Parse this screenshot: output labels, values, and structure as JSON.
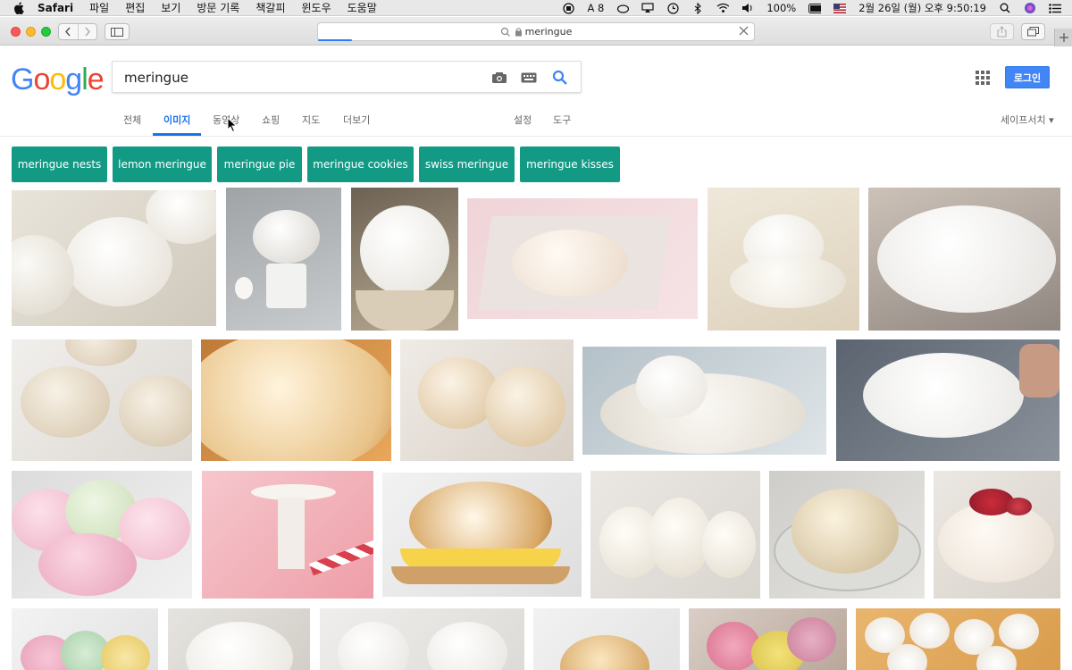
{
  "menubar": {
    "items": [
      "Safari",
      "파일",
      "편집",
      "보기",
      "방문 기록",
      "책갈피",
      "윈도우",
      "도움말"
    ],
    "status_text": "A 8",
    "battery": "100%",
    "datetime": "2월 26일 (월) 오후 9:50:19"
  },
  "browser": {
    "url": "meringue"
  },
  "google": {
    "logo_letters": [
      "G",
      "o",
      "o",
      "g",
      "l",
      "e"
    ],
    "logo_colors": [
      "#4285f4",
      "#ea4335",
      "#fbbc05",
      "#4285f4",
      "#34a853",
      "#ea4335"
    ],
    "query": "meringue",
    "login_label": "로그인",
    "tabs": [
      {
        "label": "전체",
        "active": false
      },
      {
        "label": "이미지",
        "active": true
      },
      {
        "label": "동영상",
        "active": false
      },
      {
        "label": "쇼핑",
        "active": false
      },
      {
        "label": "지도",
        "active": false
      },
      {
        "label": "더보기",
        "active": false
      }
    ],
    "settings_label": "설정",
    "tools_label": "도구",
    "safesearch_label": "세이프서치 ▾",
    "accent_color": "#1a73e8",
    "chip_color": "#129a85"
  },
  "chips": [
    "meringue nests",
    "lemon meringue",
    "meringue pie",
    "meringue cookies",
    "swiss meringue",
    "meringue kisses"
  ]
}
